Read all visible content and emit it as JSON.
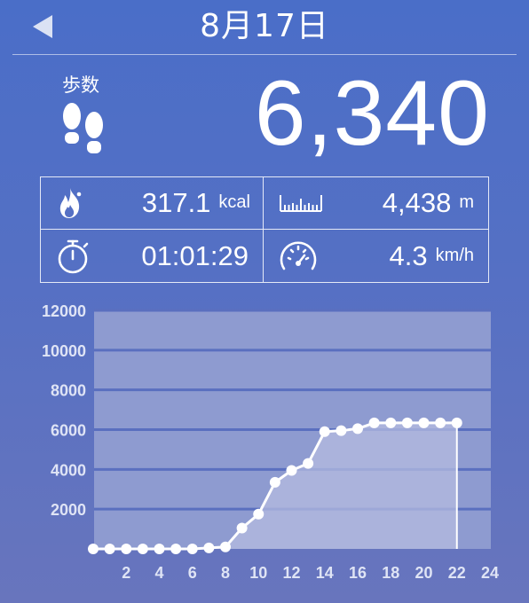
{
  "header": {
    "back_icon": "back-triangle-icon",
    "date": "8月17日"
  },
  "steps": {
    "label": "歩数",
    "icon": "footprints-icon",
    "value": "6,340"
  },
  "stats": {
    "calories": {
      "icon": "flame-icon",
      "value": "317.1",
      "unit": "kcal"
    },
    "distance": {
      "icon": "ruler-icon",
      "value": "4,438",
      "unit": "m"
    },
    "duration": {
      "icon": "stopwatch-icon",
      "value": "01:01:29"
    },
    "speed": {
      "icon": "speedometer-icon",
      "value": "4.3",
      "unit": "km/h"
    }
  },
  "chart_data": {
    "type": "area",
    "ylim": [
      0,
      12000
    ],
    "xlim": [
      0,
      24
    ],
    "y_ticks": [
      "12000",
      "10000",
      "8000",
      "6000",
      "4000",
      "2000"
    ],
    "x_ticks": [
      "2",
      "4",
      "6",
      "8",
      "10",
      "12",
      "14",
      "16",
      "18",
      "20",
      "22",
      "24"
    ],
    "grid": true,
    "series": [
      {
        "x": [
          0,
          1,
          2,
          3,
          4,
          5,
          6,
          7,
          8,
          9,
          10,
          11,
          12,
          13,
          14,
          15,
          16,
          17,
          18,
          19,
          20,
          21,
          22
        ],
        "values": [
          0,
          0,
          0,
          0,
          0,
          0,
          0,
          50,
          100,
          1050,
          1750,
          3350,
          3950,
          4300,
          5900,
          5950,
          6050,
          6340,
          6340,
          6340,
          6340,
          6340,
          6340
        ]
      }
    ],
    "colors": {
      "plot_bg": "#8e9bd0",
      "area_fill": "#b4bbe0",
      "line": "#ffffff",
      "grid": "#5a6fbf",
      "tick_text": "#dfe4f5"
    }
  }
}
